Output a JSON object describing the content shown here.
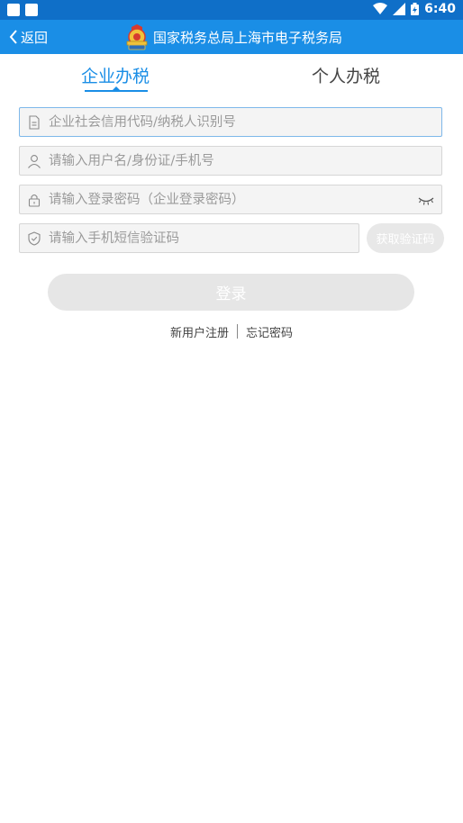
{
  "status_bar": {
    "time": "6:40"
  },
  "header": {
    "back_label": "返回",
    "title": "国家税务总局上海市电子税务局"
  },
  "tabs": [
    {
      "label": "企业办税",
      "active": true
    },
    {
      "label": "个人办税",
      "active": false
    }
  ],
  "form": {
    "credit_code": {
      "placeholder": "企业社会信用代码/纳税人识别号",
      "value": ""
    },
    "username": {
      "placeholder": "请输入用户名/身份证/手机号",
      "value": ""
    },
    "password": {
      "placeholder": "请输入登录密码（企业登录密码）",
      "value": ""
    },
    "sms_code": {
      "placeholder": "请输入手机短信验证码",
      "value": ""
    },
    "sms_button_label": "获取验证码",
    "login_label": "登录"
  },
  "links": {
    "register_label": "新用户注册",
    "forgot_label": "忘记密码"
  },
  "colors": {
    "status_bar": "#0f6fc8",
    "header": "#1a8ee6",
    "accent": "#1a8ee6",
    "disabled_button": "#e6e6e6"
  }
}
